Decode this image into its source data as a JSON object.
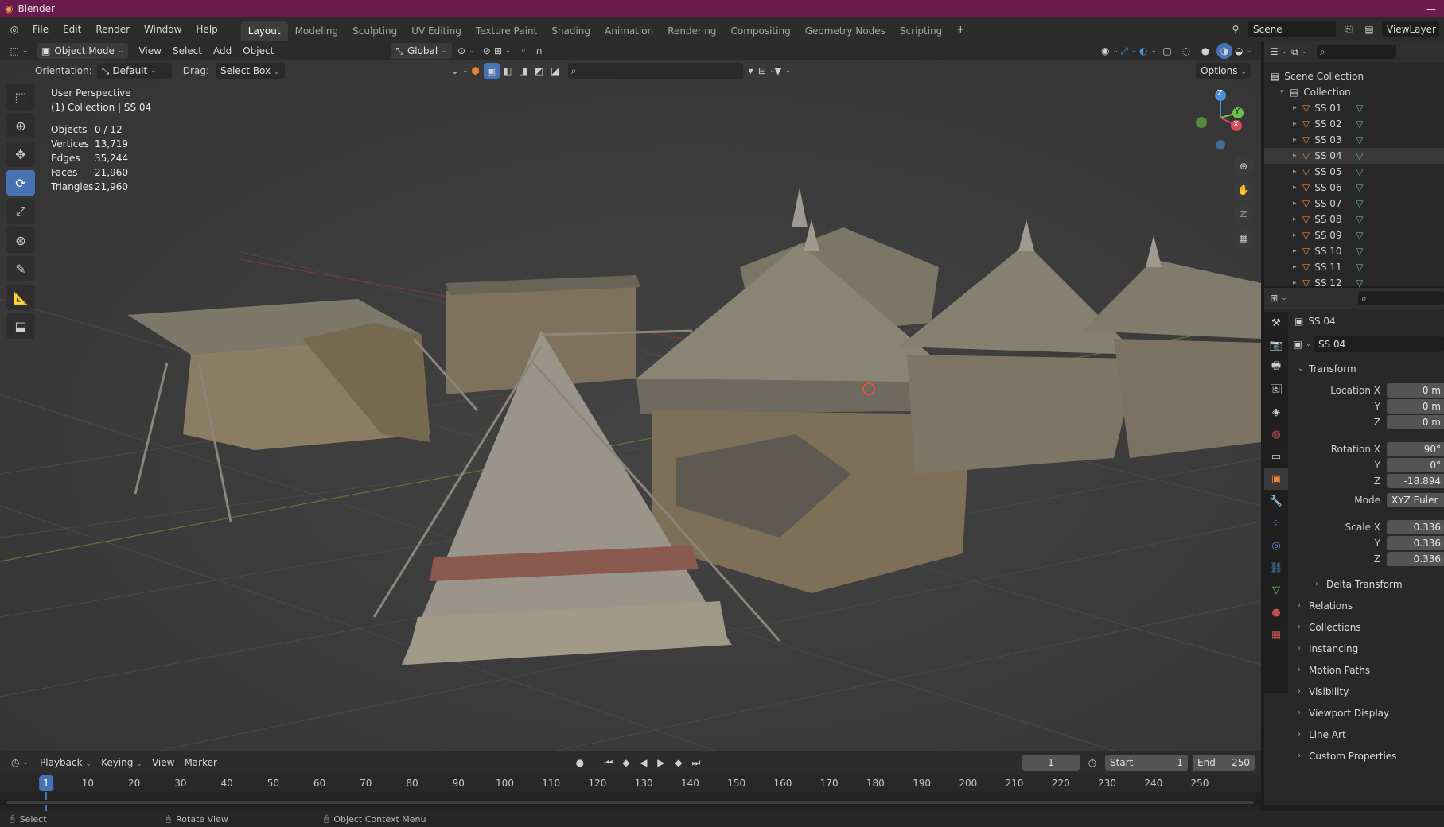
{
  "app": {
    "title": "Blender"
  },
  "menu": {
    "items": [
      "File",
      "Edit",
      "Render",
      "Window",
      "Help"
    ]
  },
  "workspaces": [
    {
      "label": "Layout",
      "active": true
    },
    {
      "label": "Modeling"
    },
    {
      "label": "Sculpting"
    },
    {
      "label": "UV Editing"
    },
    {
      "label": "Texture Paint"
    },
    {
      "label": "Shading"
    },
    {
      "label": "Animation"
    },
    {
      "label": "Rendering"
    },
    {
      "label": "Compositing"
    },
    {
      "label": "Geometry Nodes"
    },
    {
      "label": "Scripting"
    }
  ],
  "add_workspace": "+",
  "scene": {
    "name": "Scene",
    "view_layer": "ViewLayer"
  },
  "viewport_header": {
    "mode": "Object Mode",
    "menus": [
      "View",
      "Select",
      "Add",
      "Object"
    ],
    "transform_orientation": "Global",
    "options_label": "Options"
  },
  "viewport_sub": {
    "orientation_label": "Orientation:",
    "orientation_value": "Default",
    "drag_label": "Drag:",
    "drag_value": "Select Box"
  },
  "overlay_text": {
    "perspective": "User Perspective",
    "context": "(1) Collection | SS 04"
  },
  "stats": [
    {
      "label": "Objects",
      "value": "0 / 12"
    },
    {
      "label": "Vertices",
      "value": "13,719"
    },
    {
      "label": "Edges",
      "value": "35,244"
    },
    {
      "label": "Faces",
      "value": "21,960"
    },
    {
      "label": "Triangles",
      "value": "21,960"
    }
  ],
  "gizmo": {
    "x": "X",
    "y": "Y",
    "z": "Z"
  },
  "outliner": {
    "scene_collection": "Scene Collection",
    "collection": "Collection",
    "objects": [
      "SS 01",
      "SS 02",
      "SS 03",
      "SS 04",
      "SS 05",
      "SS 06",
      "SS 07",
      "SS 08",
      "SS 09",
      "SS 10",
      "SS 11",
      "SS 12"
    ],
    "selected": "SS 04"
  },
  "properties": {
    "object_name": "SS 04",
    "data_name": "SS 04",
    "transform_label": "Transform",
    "location_label": "Location X",
    "rotation_label": "Rotation X",
    "scale_label": "Scale X",
    "y_label": "Y",
    "z_label": "Z",
    "mode_label": "Mode",
    "location": [
      "0 m",
      "0 m",
      "0 m"
    ],
    "rotation": [
      "90°",
      "0°",
      "-18.894"
    ],
    "mode": "XYZ Euler",
    "scale": [
      "0.336",
      "0.336",
      "0.336"
    ],
    "sections": [
      "Delta Transform",
      "Relations",
      "Collections",
      "Instancing",
      "Motion Paths",
      "Visibility",
      "Viewport Display",
      "Line Art",
      "Custom Properties"
    ]
  },
  "timeline": {
    "menus": [
      "Playback",
      "Keying",
      "View",
      "Marker"
    ],
    "current_frame": "1",
    "start_label": "Start",
    "start": "1",
    "end_label": "End",
    "end": "250",
    "ticks": [
      "10",
      "20",
      "30",
      "40",
      "50",
      "60",
      "70",
      "80",
      "90",
      "100",
      "110",
      "120",
      "130",
      "140",
      "150",
      "160",
      "170",
      "180",
      "190",
      "200",
      "210",
      "220",
      "230",
      "240",
      "250"
    ]
  },
  "statusbar": {
    "select": "Select",
    "rotate": "Rotate View",
    "context_menu": "Object Context Menu"
  },
  "colors": {
    "accent": "#4772b3",
    "titlebar": "#6a1a4c",
    "mesh_icon": "#e8843c",
    "data_icon": "#5fbf6a"
  }
}
